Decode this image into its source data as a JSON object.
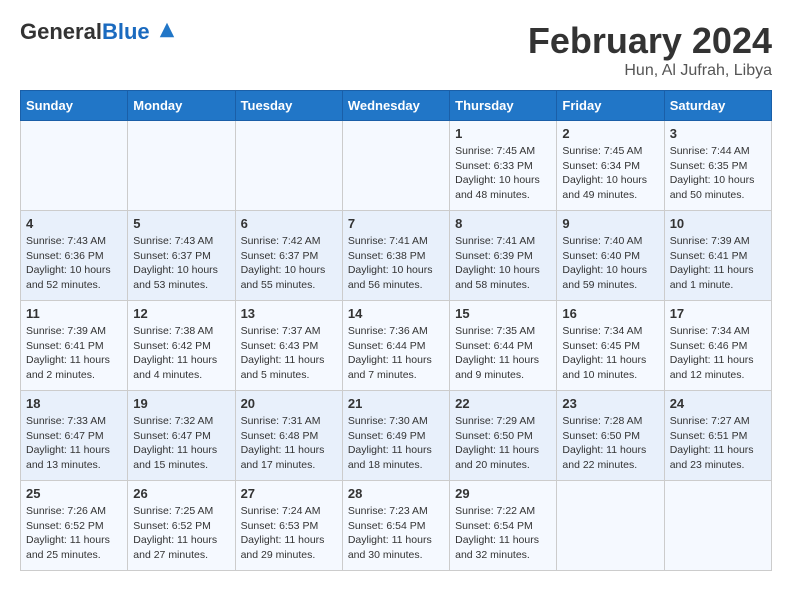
{
  "logo": {
    "general": "General",
    "blue": "Blue"
  },
  "title": "February 2024",
  "location": "Hun, Al Jufrah, Libya",
  "days_of_week": [
    "Sunday",
    "Monday",
    "Tuesday",
    "Wednesday",
    "Thursday",
    "Friday",
    "Saturday"
  ],
  "weeks": [
    [
      {
        "day": "",
        "sunrise": "",
        "sunset": "",
        "daylight": ""
      },
      {
        "day": "",
        "sunrise": "",
        "sunset": "",
        "daylight": ""
      },
      {
        "day": "",
        "sunrise": "",
        "sunset": "",
        "daylight": ""
      },
      {
        "day": "",
        "sunrise": "",
        "sunset": "",
        "daylight": ""
      },
      {
        "day": "1",
        "sunrise": "Sunrise: 7:45 AM",
        "sunset": "Sunset: 6:33 PM",
        "daylight": "Daylight: 10 hours and 48 minutes."
      },
      {
        "day": "2",
        "sunrise": "Sunrise: 7:45 AM",
        "sunset": "Sunset: 6:34 PM",
        "daylight": "Daylight: 10 hours and 49 minutes."
      },
      {
        "day": "3",
        "sunrise": "Sunrise: 7:44 AM",
        "sunset": "Sunset: 6:35 PM",
        "daylight": "Daylight: 10 hours and 50 minutes."
      }
    ],
    [
      {
        "day": "4",
        "sunrise": "Sunrise: 7:43 AM",
        "sunset": "Sunset: 6:36 PM",
        "daylight": "Daylight: 10 hours and 52 minutes."
      },
      {
        "day": "5",
        "sunrise": "Sunrise: 7:43 AM",
        "sunset": "Sunset: 6:37 PM",
        "daylight": "Daylight: 10 hours and 53 minutes."
      },
      {
        "day": "6",
        "sunrise": "Sunrise: 7:42 AM",
        "sunset": "Sunset: 6:37 PM",
        "daylight": "Daylight: 10 hours and 55 minutes."
      },
      {
        "day": "7",
        "sunrise": "Sunrise: 7:41 AM",
        "sunset": "Sunset: 6:38 PM",
        "daylight": "Daylight: 10 hours and 56 minutes."
      },
      {
        "day": "8",
        "sunrise": "Sunrise: 7:41 AM",
        "sunset": "Sunset: 6:39 PM",
        "daylight": "Daylight: 10 hours and 58 minutes."
      },
      {
        "day": "9",
        "sunrise": "Sunrise: 7:40 AM",
        "sunset": "Sunset: 6:40 PM",
        "daylight": "Daylight: 10 hours and 59 minutes."
      },
      {
        "day": "10",
        "sunrise": "Sunrise: 7:39 AM",
        "sunset": "Sunset: 6:41 PM",
        "daylight": "Daylight: 11 hours and 1 minute."
      }
    ],
    [
      {
        "day": "11",
        "sunrise": "Sunrise: 7:39 AM",
        "sunset": "Sunset: 6:41 PM",
        "daylight": "Daylight: 11 hours and 2 minutes."
      },
      {
        "day": "12",
        "sunrise": "Sunrise: 7:38 AM",
        "sunset": "Sunset: 6:42 PM",
        "daylight": "Daylight: 11 hours and 4 minutes."
      },
      {
        "day": "13",
        "sunrise": "Sunrise: 7:37 AM",
        "sunset": "Sunset: 6:43 PM",
        "daylight": "Daylight: 11 hours and 5 minutes."
      },
      {
        "day": "14",
        "sunrise": "Sunrise: 7:36 AM",
        "sunset": "Sunset: 6:44 PM",
        "daylight": "Daylight: 11 hours and 7 minutes."
      },
      {
        "day": "15",
        "sunrise": "Sunrise: 7:35 AM",
        "sunset": "Sunset: 6:44 PM",
        "daylight": "Daylight: 11 hours and 9 minutes."
      },
      {
        "day": "16",
        "sunrise": "Sunrise: 7:34 AM",
        "sunset": "Sunset: 6:45 PM",
        "daylight": "Daylight: 11 hours and 10 minutes."
      },
      {
        "day": "17",
        "sunrise": "Sunrise: 7:34 AM",
        "sunset": "Sunset: 6:46 PM",
        "daylight": "Daylight: 11 hours and 12 minutes."
      }
    ],
    [
      {
        "day": "18",
        "sunrise": "Sunrise: 7:33 AM",
        "sunset": "Sunset: 6:47 PM",
        "daylight": "Daylight: 11 hours and 13 minutes."
      },
      {
        "day": "19",
        "sunrise": "Sunrise: 7:32 AM",
        "sunset": "Sunset: 6:47 PM",
        "daylight": "Daylight: 11 hours and 15 minutes."
      },
      {
        "day": "20",
        "sunrise": "Sunrise: 7:31 AM",
        "sunset": "Sunset: 6:48 PM",
        "daylight": "Daylight: 11 hours and 17 minutes."
      },
      {
        "day": "21",
        "sunrise": "Sunrise: 7:30 AM",
        "sunset": "Sunset: 6:49 PM",
        "daylight": "Daylight: 11 hours and 18 minutes."
      },
      {
        "day": "22",
        "sunrise": "Sunrise: 7:29 AM",
        "sunset": "Sunset: 6:50 PM",
        "daylight": "Daylight: 11 hours and 20 minutes."
      },
      {
        "day": "23",
        "sunrise": "Sunrise: 7:28 AM",
        "sunset": "Sunset: 6:50 PM",
        "daylight": "Daylight: 11 hours and 22 minutes."
      },
      {
        "day": "24",
        "sunrise": "Sunrise: 7:27 AM",
        "sunset": "Sunset: 6:51 PM",
        "daylight": "Daylight: 11 hours and 23 minutes."
      }
    ],
    [
      {
        "day": "25",
        "sunrise": "Sunrise: 7:26 AM",
        "sunset": "Sunset: 6:52 PM",
        "daylight": "Daylight: 11 hours and 25 minutes."
      },
      {
        "day": "26",
        "sunrise": "Sunrise: 7:25 AM",
        "sunset": "Sunset: 6:52 PM",
        "daylight": "Daylight: 11 hours and 27 minutes."
      },
      {
        "day": "27",
        "sunrise": "Sunrise: 7:24 AM",
        "sunset": "Sunset: 6:53 PM",
        "daylight": "Daylight: 11 hours and 29 minutes."
      },
      {
        "day": "28",
        "sunrise": "Sunrise: 7:23 AM",
        "sunset": "Sunset: 6:54 PM",
        "daylight": "Daylight: 11 hours and 30 minutes."
      },
      {
        "day": "29",
        "sunrise": "Sunrise: 7:22 AM",
        "sunset": "Sunset: 6:54 PM",
        "daylight": "Daylight: 11 hours and 32 minutes."
      },
      {
        "day": "",
        "sunrise": "",
        "sunset": "",
        "daylight": ""
      },
      {
        "day": "",
        "sunrise": "",
        "sunset": "",
        "daylight": ""
      }
    ]
  ]
}
